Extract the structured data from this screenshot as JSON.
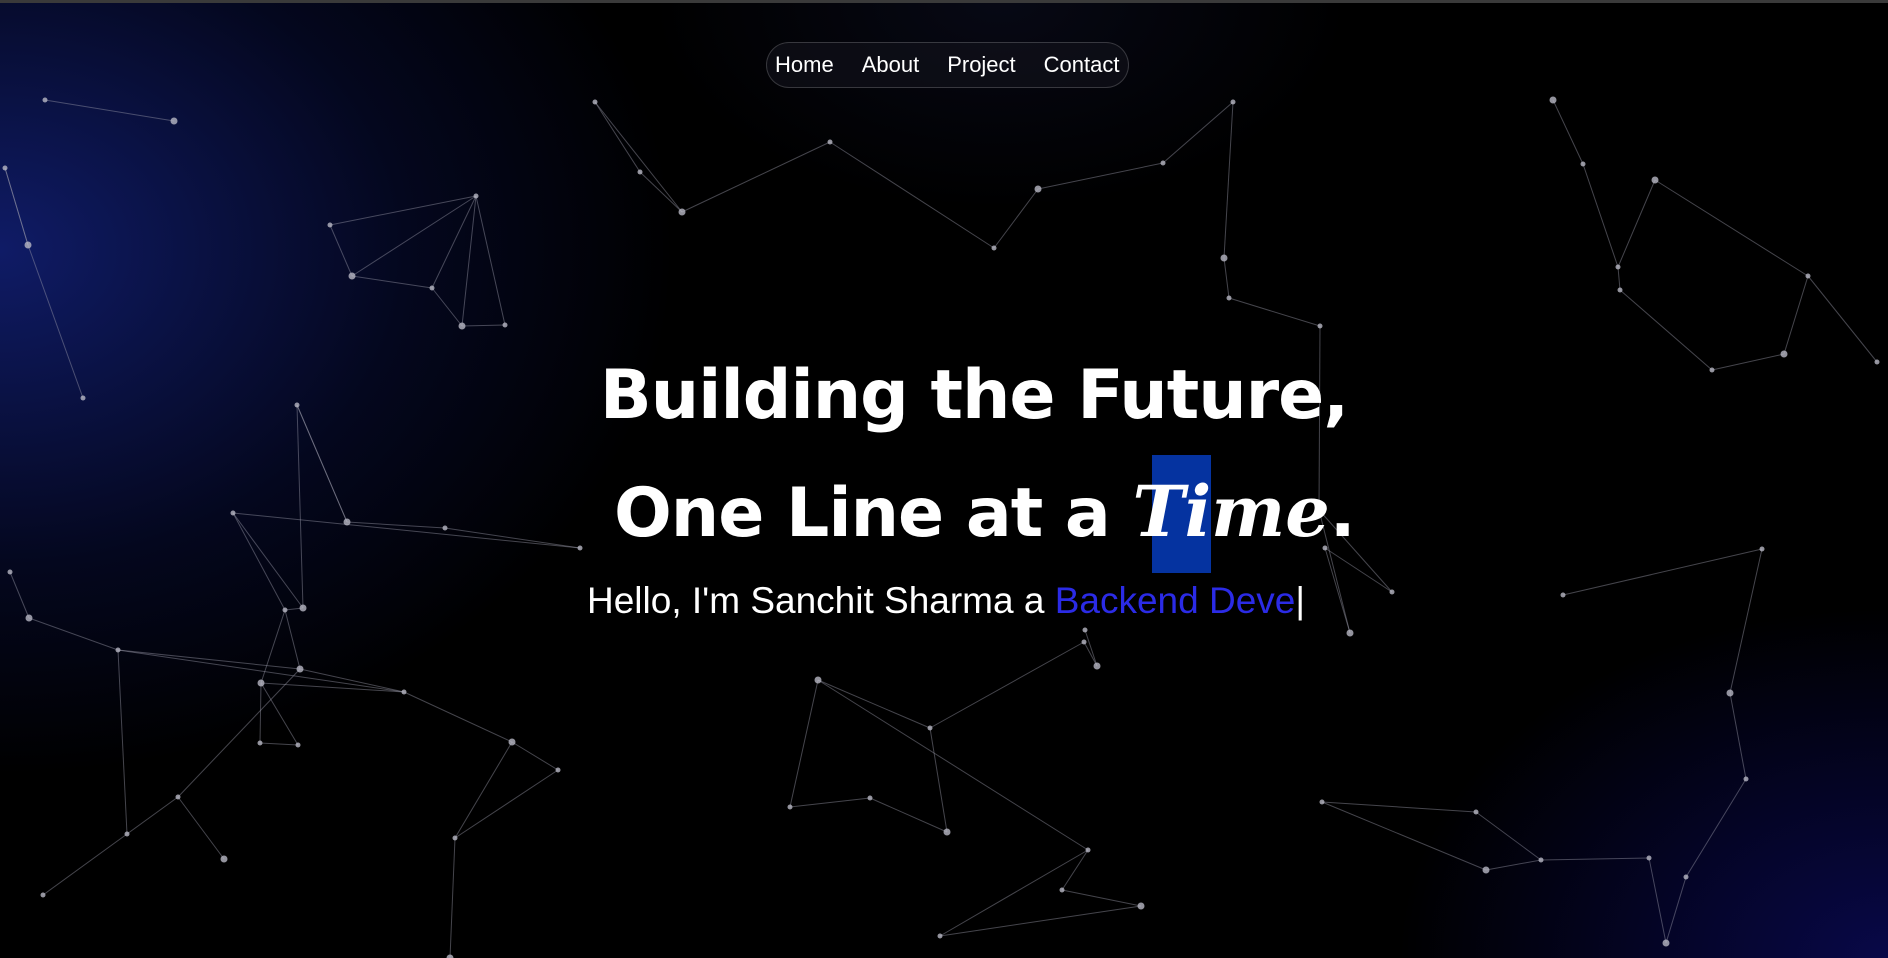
{
  "nav": {
    "items": [
      "Home",
      "About",
      "Project",
      "Contact"
    ]
  },
  "hero": {
    "line1": "Building the Future,",
    "line2_prefix": "One Line at a ",
    "line2_highlight": "Time",
    "line2_suffix": ".",
    "greeting": "Hello, I'm Sanchit Sharma a ",
    "typed_role": "Backend Deve",
    "cursor": "|"
  },
  "colors": {
    "background": "#000000",
    "accent_typed": "#2b2be6",
    "selection": "#0533a0",
    "network_lines": "#9a9aa8"
  }
}
